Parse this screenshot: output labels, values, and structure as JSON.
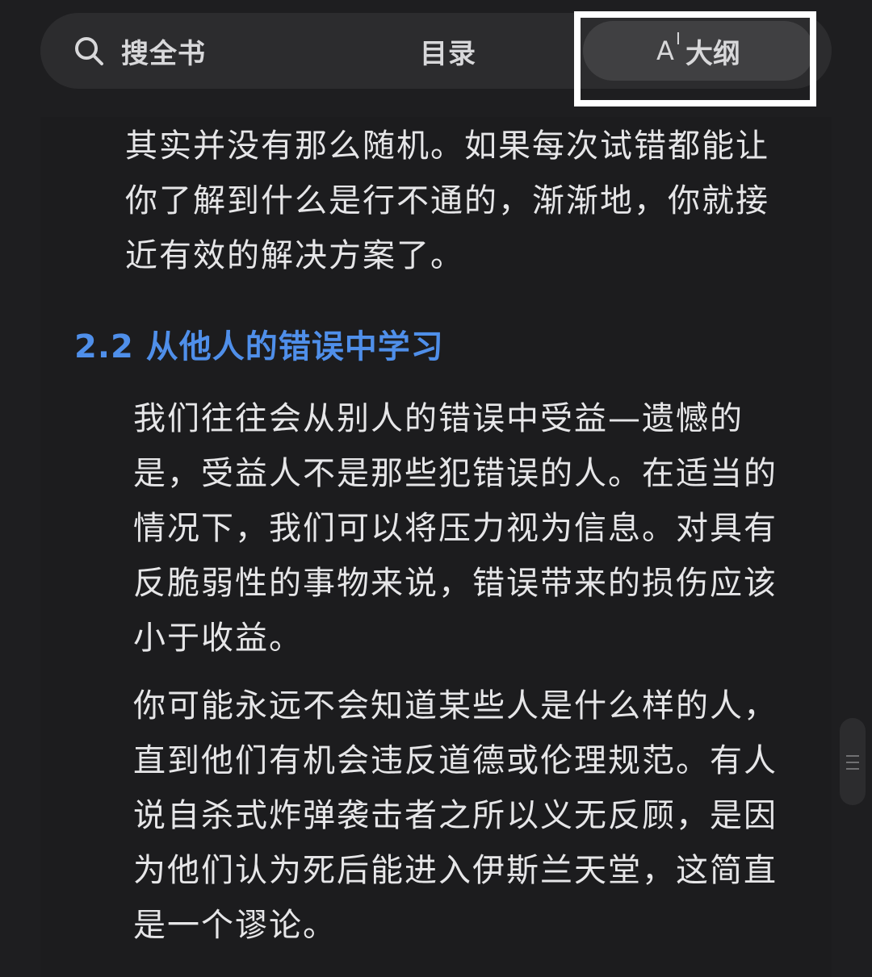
{
  "toolbar": {
    "search_label": "搜全书",
    "toc_label": "目录",
    "outline_icon_text": "A",
    "outline_label": "大纲"
  },
  "content": {
    "paragraph_1": "其实并没有那么随机。如果每次试错都能让你了解到什么是行不通的，渐渐地，你就接近有效的解决方案了。",
    "section_heading": "2.2 从他人的错误中学习",
    "paragraph_2": "我们往往会从别人的错误中受益—遗憾的是，受益人不是那些犯错误的人。在适当的情况下，我们可以将压力视为信息。对具有反脆弱性的事物来说，错误带来的损伤应该小于收益。",
    "paragraph_3": "你可能永远不会知道某些人是什么样的人，直到他们有机会违反道德或伦理规范。有人说自杀式炸弹袭击者之所以义无反顾，是因为他们认为死后能进入伊斯兰天堂，这简直是一个谬论。"
  },
  "colors": {
    "background": "#1e1e20",
    "heading": "#4f8fea",
    "highlight": "#ffffff"
  }
}
